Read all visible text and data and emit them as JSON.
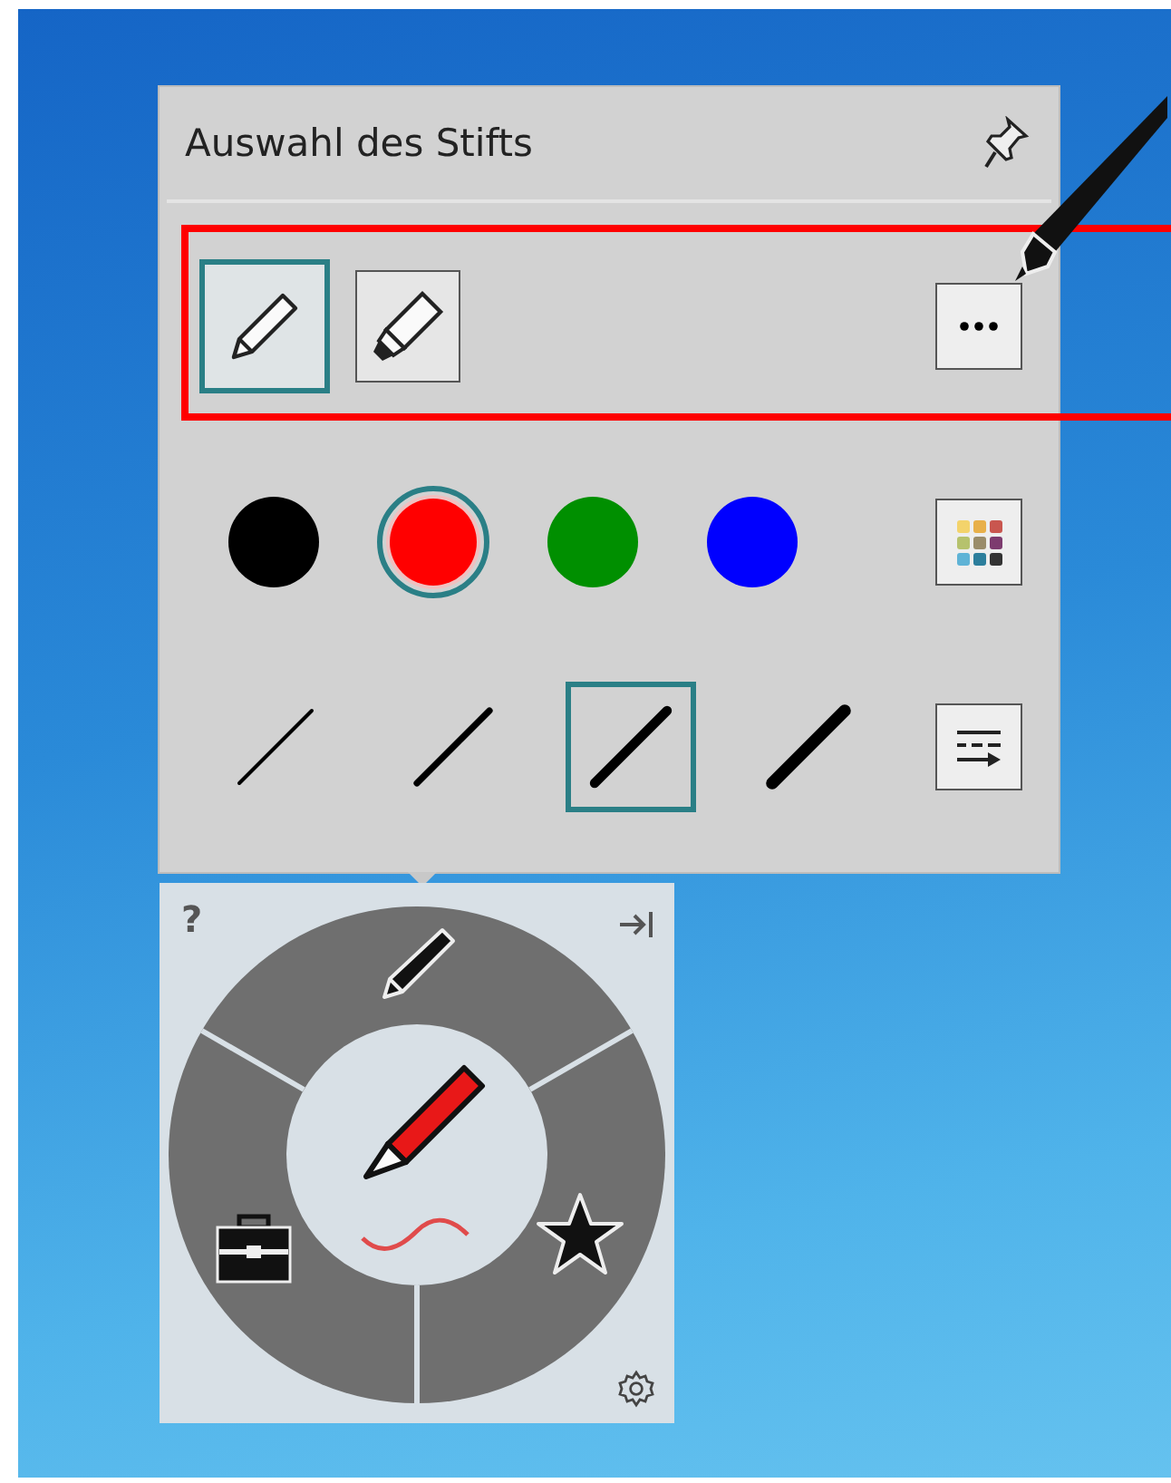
{
  "pen_panel": {
    "title": "Auswahl des Stifts",
    "pen_types": [
      {
        "kind": "pencil",
        "selected": true
      },
      {
        "kind": "highlighter",
        "selected": false
      }
    ],
    "colors": [
      {
        "color": "#000000",
        "selected": false
      },
      {
        "color": "#ff0000",
        "selected": true
      },
      {
        "color": "#008f00",
        "selected": false
      },
      {
        "color": "#0000ff",
        "selected": false
      }
    ],
    "widths": [
      {
        "selected": false
      },
      {
        "selected": false
      },
      {
        "selected": true
      },
      {
        "selected": false
      }
    ]
  },
  "radial_menu": {
    "help": "?"
  }
}
